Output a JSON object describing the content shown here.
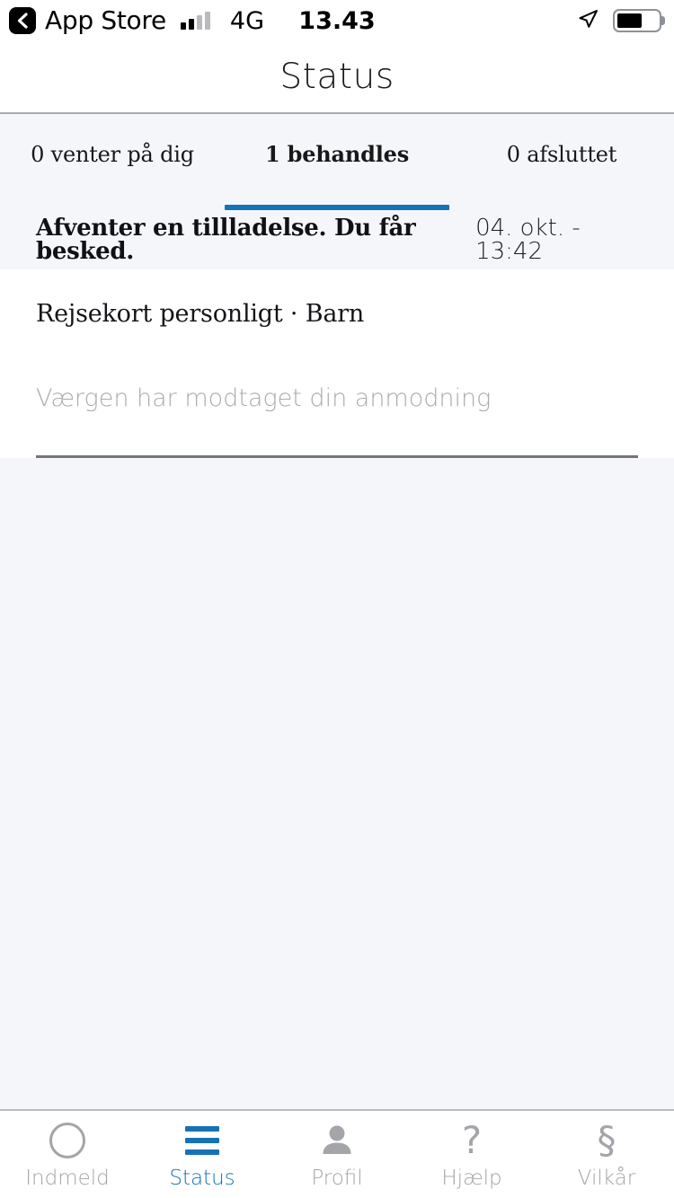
{
  "statusbar": {
    "back_label": "App Store",
    "back_icon": "chevron-left-icon",
    "signal_icon": "cellular-signal-icon",
    "signal_bars_filled": 2,
    "signal_bars_total": 4,
    "carrier": "4G",
    "time": "13.43",
    "location_icon": "location-arrow-icon",
    "battery_icon": "battery-icon",
    "battery_percent": 62
  },
  "navbar": {
    "title": "Status"
  },
  "tabs": {
    "accent_color": "#1573b5",
    "items": [
      {
        "label": "0 venter på dig",
        "active": false
      },
      {
        "label": "1 behandles",
        "active": true
      },
      {
        "label": "0 afsluttet",
        "active": false
      }
    ]
  },
  "request_card": {
    "status_title": "Afventer en tillladelse. Du får besked.",
    "date": "04. okt. - 13:42",
    "product": "Rejsekort personligt · Barn",
    "note": "Værgen har modtaget din anmodning"
  },
  "tabbar": {
    "active_color": "#1573b5",
    "inactive_color": "#a3a5a9",
    "items": [
      {
        "label": "Indmeld",
        "icon": "circle-outline-icon",
        "active": false
      },
      {
        "label": "Status",
        "icon": "list-bars-icon",
        "active": true
      },
      {
        "label": "Profil",
        "icon": "person-icon",
        "active": false
      },
      {
        "label": "Hjælp",
        "icon": "question-mark-icon",
        "glyph": "?",
        "active": false
      },
      {
        "label": "Vilkår",
        "icon": "section-sign-icon",
        "glyph": "§",
        "active": false
      }
    ]
  }
}
